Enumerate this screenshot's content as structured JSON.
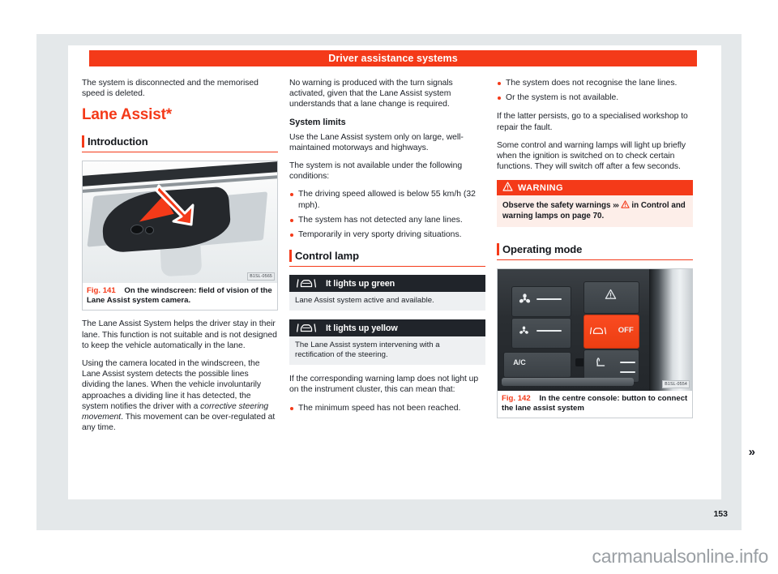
{
  "chapter": {
    "title": "Driver assistance systems"
  },
  "page_number": "153",
  "watermark": "carmanualsonline.info",
  "next_page_arrow": "»",
  "column_left": {
    "intro_paragraph": "The system is disconnected and the memorised speed is deleted.",
    "section_title": "Lane Assist*",
    "sub_heading": "Introduction",
    "figure": {
      "number": "Fig. 141",
      "caption": "On the windscreen: field of vision of the Lane Assist system camera.",
      "image_code": "B1SL-0565",
      "alt": "windscreen-camera-housing"
    },
    "paragraph_1": "The Lane Assist System helps the driver stay in their lane. This function is not suitable and is not designed to keep the vehicle automatically in the lane.",
    "paragraph_2_a": "Using the camera located in the windscreen, the Lane Assist system detects the possible lines dividing the lanes. When the vehicle involuntarily approaches a dividing line it has detected, the system notifies the driver with a ",
    "paragraph_2_italic": "corrective steering movement",
    "paragraph_2_b": ". This movement can be over-regulated at any time."
  },
  "column_middle": {
    "paragraph_1": "No warning is produced with the turn signals activated, given that the Lane Assist system understands that a lane change is required.",
    "mini_heading": "System limits",
    "paragraph_2": "Use the Lane Assist system only on large, well-maintained motorways and highways.",
    "paragraph_3": "The system is not available under the following conditions:",
    "bullets": [
      "The driving speed allowed is below 55 km/h (32 mph).",
      "The system has not detected any lane lines.",
      "Temporarily in very sporty driving situations."
    ],
    "control_lamp_heading": "Control lamp",
    "lamps": [
      {
        "icon": "lane-assist-icon",
        "title": "It lights up green",
        "description": "Lane Assist system active and available."
      },
      {
        "icon": "lane-assist-icon",
        "title": "It lights up yellow",
        "description": "The Lane Assist system intervening with a rectification of the steering."
      }
    ],
    "paragraph_4": "If the corresponding warning lamp does not light up on the instrument cluster, this can mean that:",
    "bullets_2": [
      "The minimum speed has not been reached."
    ]
  },
  "column_right": {
    "bullets": [
      "The system does not recognise the lane lines.",
      "Or the system is not available."
    ],
    "paragraph_1": "If the latter persists, go to a specialised workshop to repair the fault.",
    "paragraph_2": "Some control and warning lamps will light up briefly when the ignition is switched on to check certain functions. They will switch off after a few seconds.",
    "warning": {
      "label": "WARNING",
      "icon": "warning-triangle-icon",
      "text_before": "Observe the safety warnings ",
      "chevrons": "›››",
      "text_after": " in Control and warning lamps on page 70."
    },
    "sub_heading": "Operating mode",
    "figure": {
      "number": "Fig. 142",
      "caption": "In the centre console: button to connect the lane assist system",
      "image_code": "B1SL-0554",
      "alt": "centre-console-lane-assist-button",
      "console": {
        "fan_high_icon": "fan-icon",
        "fan_low_icon": "fan-icon",
        "ac_label": "A/C",
        "hazard_icon": "hazard-triangle-icon",
        "lane_assist_button_label": "OFF",
        "lane_assist_button_icon": "lane-assist-icon",
        "seat_heating_icon": "seat-heating-icon"
      }
    }
  },
  "colors": {
    "brand_red": "#f43a19",
    "dark": "#20242a",
    "mat": "#e4e8ea",
    "lamp_body": "#eef0f2",
    "warning_body": "#fdeee9"
  }
}
